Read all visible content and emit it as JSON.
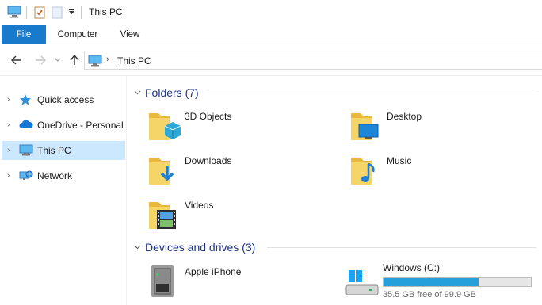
{
  "window": {
    "title": "This PC"
  },
  "ribbon": {
    "tabs": [
      "File",
      "Computer",
      "View"
    ]
  },
  "address": {
    "path": "This PC"
  },
  "nav_pane": {
    "items": [
      {
        "label": "Quick access",
        "icon": "star-icon"
      },
      {
        "label": "OneDrive - Personal",
        "icon": "cloud-icon"
      },
      {
        "label": "This PC",
        "icon": "computer-icon",
        "selected": true
      },
      {
        "label": "Network",
        "icon": "network-icon"
      }
    ]
  },
  "folders": {
    "header": "Folders (7)",
    "items": [
      {
        "label": "3D Objects",
        "icon": "3d-objects-folder-icon"
      },
      {
        "label": "Desktop",
        "icon": "desktop-folder-icon"
      },
      {
        "label": "Downloads",
        "icon": "downloads-folder-icon"
      },
      {
        "label": "Music",
        "icon": "music-folder-icon"
      },
      {
        "label": "Videos",
        "icon": "videos-folder-icon"
      }
    ]
  },
  "devices": {
    "header": "Devices and drives (3)",
    "items": [
      {
        "label": "Apple iPhone",
        "icon": "phone-device-icon"
      },
      {
        "label": "Windows (C:)",
        "icon": "windows-drive-icon",
        "free_text": "35.5 GB free of 99.9 GB",
        "used_fraction": 0.645
      }
    ]
  },
  "colors": {
    "accent": "#1979ca",
    "selection": "#cce8ff",
    "header_text": "#1e3287",
    "drive_fill": "#26a0da",
    "folder": "#f2c94c"
  }
}
